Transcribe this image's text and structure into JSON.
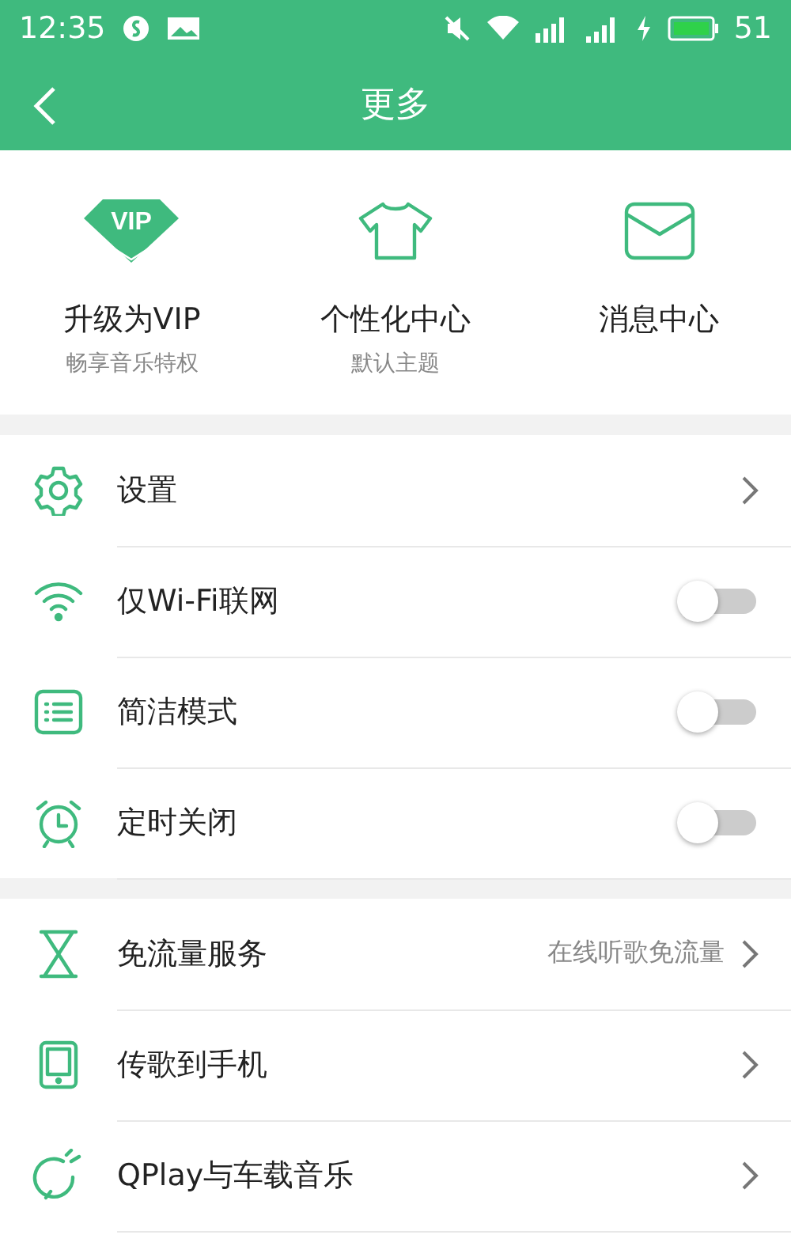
{
  "status_bar": {
    "time": "12:35",
    "battery": "51"
  },
  "header": {
    "title": "更多"
  },
  "shortcuts": [
    {
      "title": "升级为VIP",
      "subtitle": "畅享音乐特权",
      "icon_text": "VIP"
    },
    {
      "title": "个性化中心",
      "subtitle": "默认主题"
    },
    {
      "title": "消息中心"
    }
  ],
  "sections": [
    [
      {
        "kind": "link",
        "label": "设置"
      },
      {
        "kind": "toggle",
        "label": "仅Wi-Fi联网",
        "on": false
      },
      {
        "kind": "toggle",
        "label": "简洁模式",
        "on": false
      },
      {
        "kind": "toggle",
        "label": "定时关闭",
        "on": false
      }
    ],
    [
      {
        "kind": "link",
        "label": "免流量服务",
        "value": "在线听歌免流量"
      },
      {
        "kind": "link",
        "label": "传歌到手机"
      },
      {
        "kind": "link",
        "label": "QPlay与车载音乐"
      }
    ]
  ]
}
